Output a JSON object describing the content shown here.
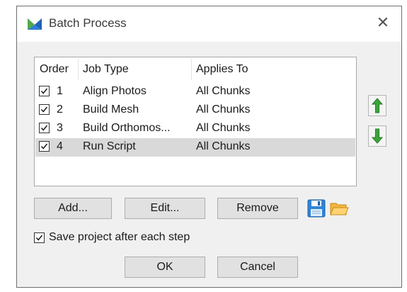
{
  "window": {
    "title": "Batch Process",
    "icon": "metashape-logo-icon",
    "close_glyph": "✕"
  },
  "job_list": {
    "columns": [
      "Order",
      "Job Type",
      "Applies To"
    ],
    "rows": [
      {
        "checked": true,
        "order": "1",
        "job_type": "Align Photos",
        "applies_to": "All Chunks",
        "selected": false
      },
      {
        "checked": true,
        "order": "2",
        "job_type": "Build Mesh",
        "applies_to": "All Chunks",
        "selected": false
      },
      {
        "checked": true,
        "order": "3",
        "job_type": "Build Orthomos...",
        "applies_to": "All Chunks",
        "selected": false
      },
      {
        "checked": true,
        "order": "4",
        "job_type": "Run Script",
        "applies_to": "All Chunks",
        "selected": true
      }
    ]
  },
  "side_buttons": {
    "move_up_icon": "arrow-up-icon",
    "move_down_icon": "arrow-down-icon",
    "arrow_color": "#2e9a2e"
  },
  "actions": {
    "add_label": "Add...",
    "edit_label": "Edit...",
    "remove_label": "Remove",
    "save_icon": "floppy-disk-icon",
    "open_icon": "folder-icon"
  },
  "options": {
    "save_after_step_label": "Save project after each step",
    "save_after_step_checked": true
  },
  "footer": {
    "ok_label": "OK",
    "cancel_label": "Cancel"
  },
  "colors": {
    "selection": "#d9d9d9",
    "dialog_bg": "#f0f0f0",
    "button_bg": "#e1e1e1"
  }
}
